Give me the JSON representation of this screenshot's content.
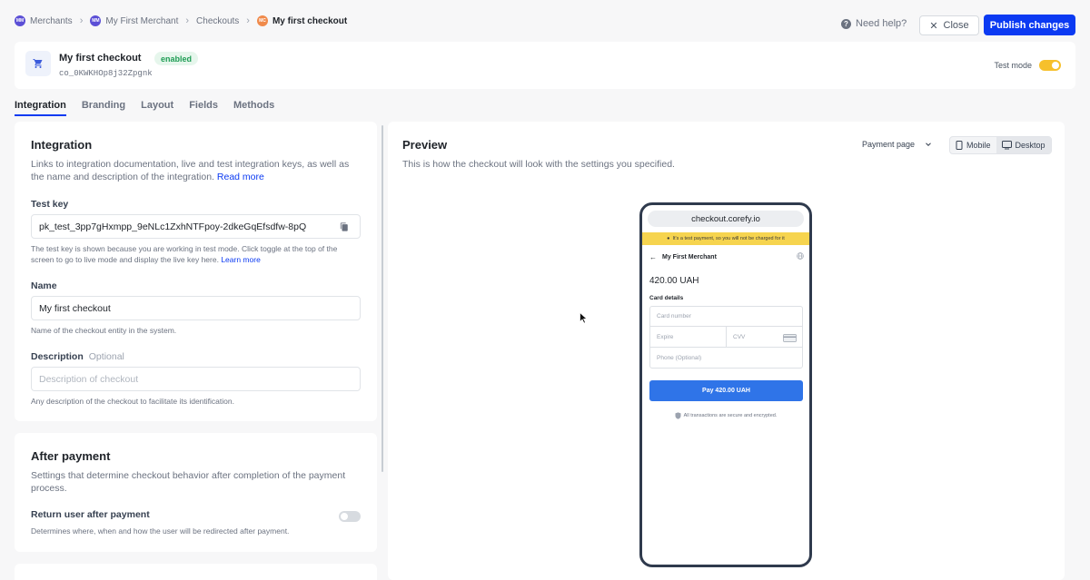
{
  "breadcrumb": {
    "items": [
      {
        "badge": "MM",
        "label": "Merchants"
      },
      {
        "badge": "MM",
        "label": "My First Merchant"
      },
      {
        "label": "Checkouts"
      },
      {
        "badge": "MC",
        "label": "My first checkout"
      }
    ]
  },
  "topbar": {
    "help_label": "Need help?",
    "close_label": "Close",
    "publish_label": "Publish changes",
    "accent_color": "#0b3af2"
  },
  "checkout": {
    "title": "My first checkout",
    "status": "enabled",
    "id": "co_0KWKHOp8j32Zpgnk",
    "test_mode_label": "Test mode",
    "test_mode_on": true
  },
  "tabs": [
    "Integration",
    "Branding",
    "Layout",
    "Fields",
    "Methods"
  ],
  "integration": {
    "title": "Integration",
    "description": "Links to integration documentation, live and test integration keys, as well as the name and description of the integration.",
    "read_more": "Read more",
    "test_key_label": "Test key",
    "test_key_value": "pk_test_3pp7gHxmpp_9eNLc1ZxhNTFpoy-2dkeGqEfsdfw-8pQ",
    "test_key_hint": "The test key is shown because you are working in test mode. Click toggle at the top of the screen to go to live mode and display the live key here.",
    "learn_more": "Learn more",
    "name_label": "Name",
    "name_value": "My first checkout",
    "name_hint": "Name of the checkout entity in the system.",
    "description_label": "Description",
    "optional_label": "Optional",
    "description_placeholder": "Description of checkout",
    "description_hint": "Any description of the checkout to facilitate its identification."
  },
  "after_payment": {
    "title": "After payment",
    "description": "Settings that determine checkout behavior after completion of the payment process.",
    "return_label": "Return user after payment",
    "return_hint": "Determines where, when and how the user will be redirected after payment.",
    "return_enabled": false
  },
  "preview": {
    "title": "Preview",
    "description": "This is how the checkout will look with the settings you specified.",
    "page_select": "Payment page",
    "mobile_label": "Mobile",
    "desktop_label": "Desktop",
    "active_device": "Desktop",
    "phone": {
      "url": "checkout.corefy.io",
      "test_banner": "It's a test payment, so you will not be charged for it",
      "merchant": "My First Merchant",
      "amount": "420.00 UAH",
      "card_details_label": "Card details",
      "card_number_placeholder": "Card number",
      "expire_placeholder": "Expire",
      "cvv_placeholder": "CVV",
      "phone_placeholder": "Phone (Optional)",
      "pay_label": "Pay 420.00 UAH",
      "secure_note": "All transactions are secure and encrypted."
    }
  }
}
